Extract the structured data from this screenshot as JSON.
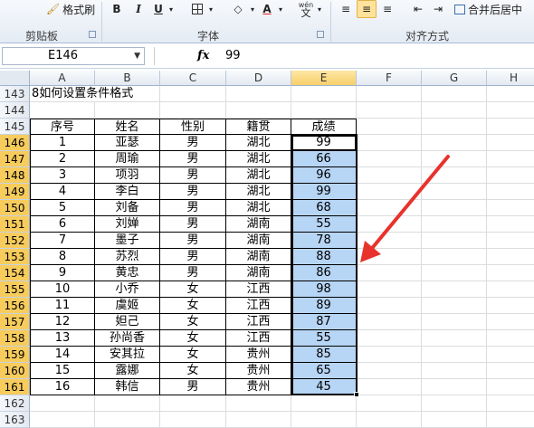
{
  "ribbon": {
    "format_painter": "格式刷",
    "bold": "B",
    "italic": "I",
    "underline": "U",
    "wen": "wén\n文",
    "merge_center": "合并后居中",
    "group_clipboard": "剪贴板",
    "group_font": "字体",
    "group_align": "对齐方式"
  },
  "formula_bar": {
    "name_box": "E146",
    "fx": "fx",
    "value": "99"
  },
  "columns": [
    "A",
    "B",
    "C",
    "D",
    "E",
    "F",
    "G",
    "H"
  ],
  "rows": [
    "143",
    "144",
    "145",
    "146",
    "147",
    "148",
    "149",
    "150",
    "151",
    "152",
    "153",
    "154",
    "155",
    "156",
    "157",
    "158",
    "159",
    "160",
    "161",
    "162",
    "163"
  ],
  "title_cell": "8如何设置条件格式",
  "table": {
    "headers": [
      "序号",
      "姓名",
      "性别",
      "籍贯",
      "成绩"
    ],
    "records": [
      [
        "1",
        "亚瑟",
        "男",
        "湖北",
        "99"
      ],
      [
        "2",
        "周瑜",
        "男",
        "湖北",
        "66"
      ],
      [
        "3",
        "项羽",
        "男",
        "湖北",
        "96"
      ],
      [
        "4",
        "李白",
        "男",
        "湖北",
        "99"
      ],
      [
        "5",
        "刘备",
        "男",
        "湖北",
        "68"
      ],
      [
        "6",
        "刘婵",
        "男",
        "湖南",
        "55"
      ],
      [
        "7",
        "墨子",
        "男",
        "湖南",
        "78"
      ],
      [
        "8",
        "苏烈",
        "男",
        "湖南",
        "88"
      ],
      [
        "9",
        "黄忠",
        "男",
        "湖南",
        "86"
      ],
      [
        "10",
        "小乔",
        "女",
        "江西",
        "98"
      ],
      [
        "11",
        "虞姬",
        "女",
        "江西",
        "89"
      ],
      [
        "12",
        "妲己",
        "女",
        "江西",
        "87"
      ],
      [
        "13",
        "孙尚香",
        "女",
        "江西",
        "55"
      ],
      [
        "14",
        "安其拉",
        "女",
        "贵州",
        "85"
      ],
      [
        "15",
        "露娜",
        "女",
        "贵州",
        "65"
      ],
      [
        "16",
        "韩信",
        "男",
        "贵州",
        "45"
      ]
    ]
  },
  "colors": {
    "selection": "#b7d5f5",
    "arrow": "#e8322c",
    "header_selected": "#f7cc5c"
  }
}
